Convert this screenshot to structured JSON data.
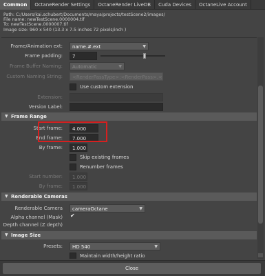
{
  "tabs": [
    "Common",
    "OctaneRender Settings",
    "OctaneRender LiveDB",
    "Cuda Devices",
    "OctaneLive Account"
  ],
  "info": {
    "path": "Path: C:/Users/kai.schubert/Documents/maya/projects/testScene2/images/",
    "file_name": "File name:  newTestScene.0000004.tif",
    "to": "To:          newTestScene.0000007.tif",
    "image_size": "Image size: 960 x 540 (13.3 x 7.5 inches 72 pixels/inch )"
  },
  "fields": {
    "frame_ext_label": "Frame/Animation ext:",
    "frame_ext_value": "name.#.ext",
    "frame_padding_label": "Frame padding:",
    "frame_padding_value": "7",
    "frame_buffer_label": "Frame Buffer Naming:",
    "frame_buffer_value": "Automatic",
    "custom_naming_label": "Custom Naming String:",
    "custom_naming_value": "<RenderPassType>:<RenderPass>.<Camera>",
    "use_custom_ext_label": "Use custom extension",
    "extension_label": "Extension:",
    "version_label": "Version Label:"
  },
  "frame_range": {
    "title": "Frame Range",
    "start_label": "Start frame:",
    "start_value": "4.000",
    "end_label": "End frame:",
    "end_value": "7.000",
    "by_label": "By frame:",
    "by_value": "1.000",
    "skip_label": "Skip existing frames",
    "renumber_label": "Renumber frames",
    "start_number_label": "Start number:",
    "start_number_value": "1.000",
    "by_frame2_label": "By frame:",
    "by_frame2_value": "1.000"
  },
  "renderable_cameras": {
    "title": "Renderable Cameras",
    "camera_label": "Renderable Camera",
    "camera_value": "cameraOctane",
    "alpha_label": "Alpha channel (Mask)",
    "depth_label": "Depth channel (Z depth)"
  },
  "image_size": {
    "title": "Image Size",
    "presets_label": "Presets:",
    "presets_value": "HD 540",
    "maintain_label": "Maintain width/height ratio"
  },
  "close_label": "Close"
}
